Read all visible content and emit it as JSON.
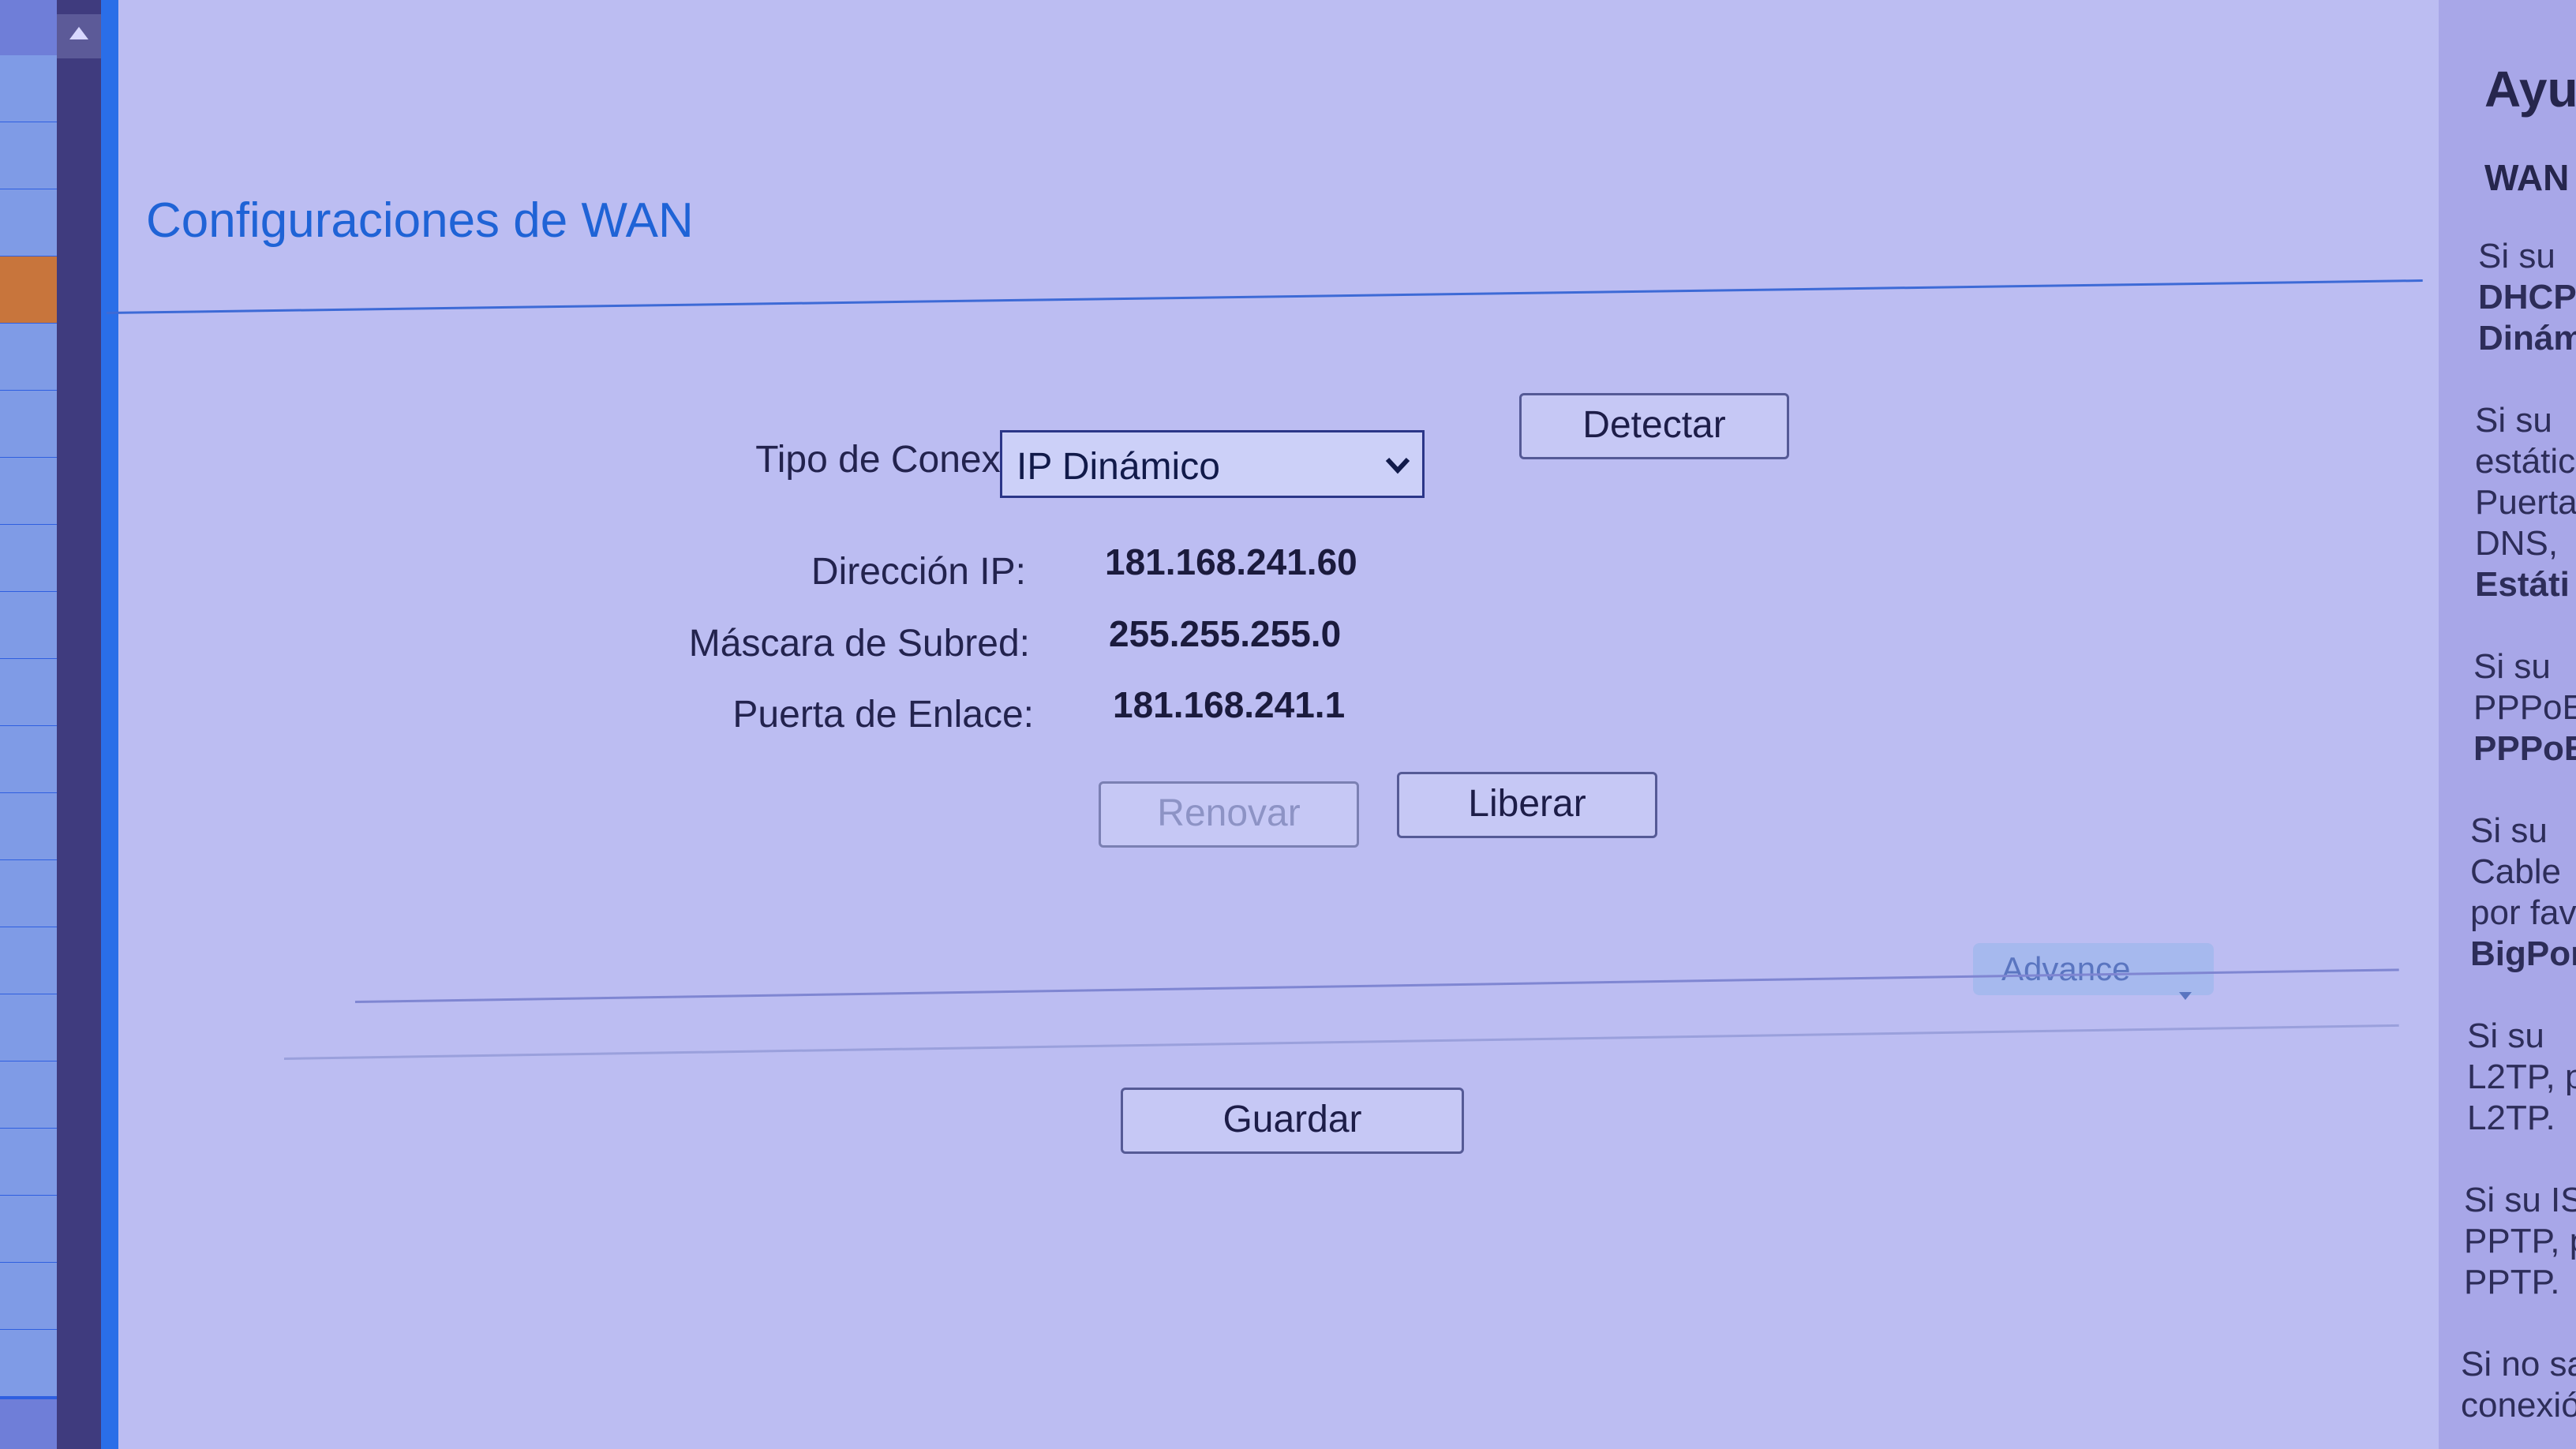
{
  "page": {
    "title": "Configuraciones de WAN"
  },
  "connection": {
    "type_label": "Tipo de Conexión:",
    "type_value": "IP Dinámico",
    "detect_button": "Detectar"
  },
  "details": {
    "ip_label": "Dirección IP:",
    "ip_value": "181.168.241.60",
    "mask_label": "Máscara de Subred:",
    "mask_value": "255.255.255.0",
    "gateway_label": "Puerta de Enlace:",
    "gateway_value": "181.168.241.1"
  },
  "actions": {
    "renew_button": "Renovar",
    "release_button": "Liberar",
    "advance_button": "Advance",
    "save_button": "Guardar"
  },
  "help": {
    "title": "Ayu",
    "heading": "WAN",
    "lines": [
      "Si su",
      "DHCP",
      "Dinám",
      "Si su",
      "estátic",
      "Puerta",
      "DNS,",
      "Estáti",
      "Si su",
      "PPPoE",
      "PPPoE",
      "Si su",
      "Cable",
      "por fav",
      "BigPor",
      "Si su",
      "L2TP, p",
      "L2TP.",
      "Si su IS",
      "PPTP, p",
      "PPTP.",
      "Si no sa",
      "conexión"
    ]
  },
  "icons": {
    "scroll_up": "scroll-up-arrow-icon",
    "dropdown": "chevron-down-icon",
    "advance": "caret-down-icon"
  }
}
